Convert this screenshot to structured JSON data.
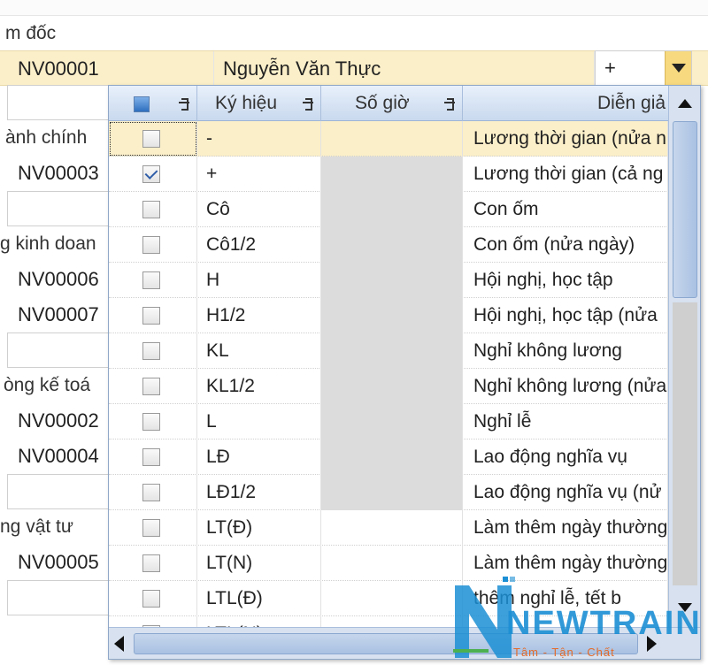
{
  "background": {
    "groups": [
      {
        "label": "m đốc"
      },
      {
        "label": "ành chính"
      },
      {
        "label": "g kinh doan"
      },
      {
        "label": "òng kế toá"
      },
      {
        "label": "ng vật tư"
      }
    ],
    "selected_row": {
      "code": "NV00001",
      "name": "Nguyễn Văn Thực",
      "value": "+"
    },
    "employee_codes": [
      "NV00003",
      "NV00006",
      "NV00007",
      "NV00002",
      "NV00004",
      "NV00005"
    ]
  },
  "dropdown": {
    "headers": {
      "code": "Ký hiệu",
      "hours": "Số giờ",
      "description": "Diễn giả"
    },
    "rows": [
      {
        "code": "-",
        "description": "Lương thời gian (nửa n",
        "checked": false,
        "hours_grey": false,
        "selected": true
      },
      {
        "code": "+",
        "description": "Lương thời gian (cả ng",
        "checked": true,
        "hours_grey": true,
        "selected": false
      },
      {
        "code": "Cô",
        "description": "Con ốm",
        "checked": false,
        "hours_grey": true,
        "selected": false
      },
      {
        "code": "Cô1/2",
        "description": "Con ốm (nửa ngày)",
        "checked": false,
        "hours_grey": true,
        "selected": false
      },
      {
        "code": "H",
        "description": "Hội nghị, học tập",
        "checked": false,
        "hours_grey": true,
        "selected": false
      },
      {
        "code": "H1/2",
        "description": "Hội nghị, học tập (nửa",
        "checked": false,
        "hours_grey": true,
        "selected": false
      },
      {
        "code": "KL",
        "description": "Nghỉ không lương",
        "checked": false,
        "hours_grey": true,
        "selected": false
      },
      {
        "code": "KL1/2",
        "description": "Nghỉ không lương (nửa",
        "checked": false,
        "hours_grey": true,
        "selected": false
      },
      {
        "code": "L",
        "description": "Nghỉ lễ",
        "checked": false,
        "hours_grey": true,
        "selected": false
      },
      {
        "code": "LĐ",
        "description": "Lao động nghĩa vụ",
        "checked": false,
        "hours_grey": true,
        "selected": false
      },
      {
        "code": "LĐ1/2",
        "description": "Lao động nghĩa vụ (nử",
        "checked": false,
        "hours_grey": true,
        "selected": false
      },
      {
        "code": "LT(Đ)",
        "description": "Làm thêm ngày thường",
        "checked": false,
        "hours_grey": false,
        "selected": false
      },
      {
        "code": "LT(N)",
        "description": "Làm thêm ngày thường",
        "checked": false,
        "hours_grey": false,
        "selected": false
      },
      {
        "code": "LTL(Đ)",
        "description": "thêm nghỉ lễ, tết b",
        "checked": false,
        "hours_grey": false,
        "selected": false
      },
      {
        "code": "LTL(N)",
        "description": "",
        "checked": false,
        "hours_grey": false,
        "selected": false
      }
    ]
  },
  "watermark": {
    "brand": "NEWTRAIN",
    "tagline": "Tâm - Tận - Chất"
  },
  "colors": {
    "selected_row": "#fbefc9",
    "header_blue": "#c9d9ee",
    "combo_button": "#f7d97f",
    "watermark_blue": "#1c8fd4",
    "watermark_orange": "#e36b2a"
  },
  "icons": [
    "pin-icon",
    "check-icon",
    "dropdown-arrow-icon",
    "scroll-up-icon",
    "scroll-down-icon",
    "scroll-left-icon",
    "scroll-right-icon"
  ]
}
